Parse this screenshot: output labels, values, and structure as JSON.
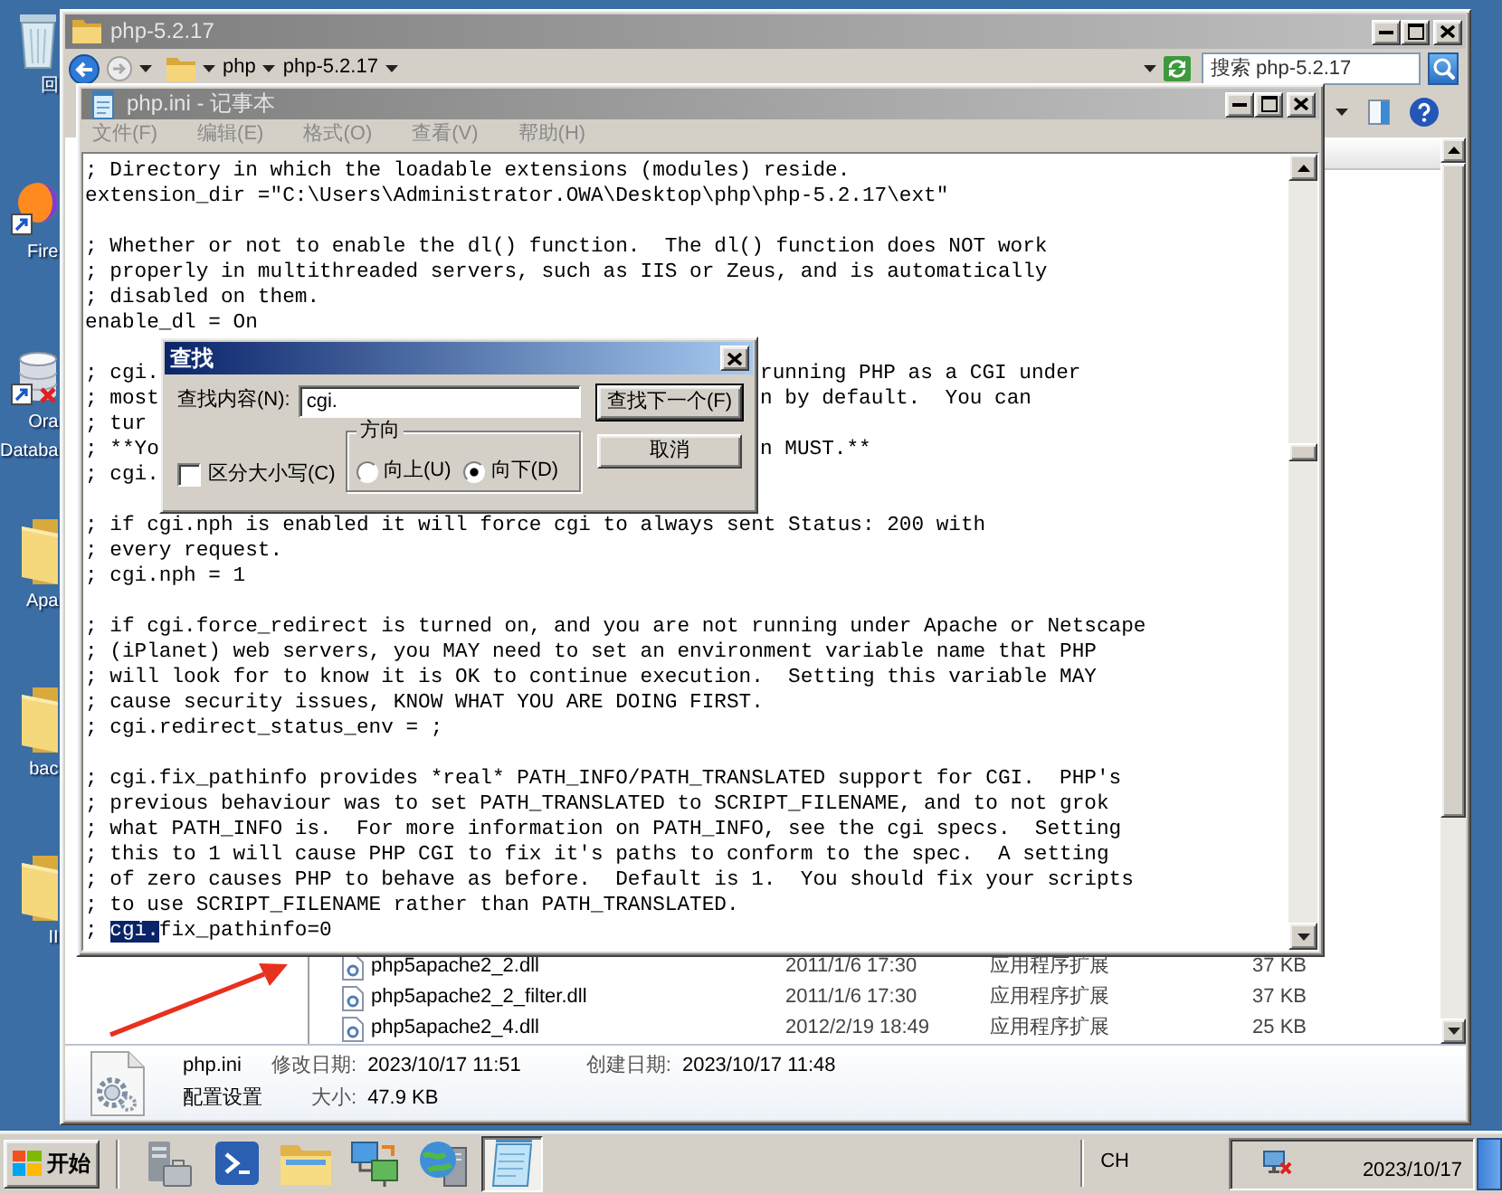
{
  "desktop_icons": [
    {
      "kind": "recycle_bin",
      "label": [
        "回"
      ]
    },
    {
      "kind": "browser_shortcut",
      "label": [
        "Fire"
      ]
    },
    {
      "kind": "database_shortcut",
      "label": [
        "Ora",
        "Databa"
      ]
    },
    {
      "kind": "folder",
      "label": [
        "Apa"
      ]
    },
    {
      "kind": "folder",
      "label": [
        "bac"
      ]
    },
    {
      "kind": "folder",
      "label": [
        "II"
      ]
    }
  ],
  "explorer": {
    "title": "php-5.2.17",
    "breadcrumb": [
      "php",
      "php-5.2.17"
    ],
    "search": {
      "placeholder": "搜索 php-5.2.17"
    },
    "files": [
      {
        "name": "php5apache2_2.dll",
        "modified": "2011/1/6 17:30",
        "type": "应用程序扩展",
        "size": "37 KB"
      },
      {
        "name": "php5apache2_2_filter.dll",
        "modified": "2011/1/6 17:30",
        "type": "应用程序扩展",
        "size": "37 KB"
      },
      {
        "name": "php5apache2_4.dll",
        "modified": "2012/2/19 18:49",
        "type": "应用程序扩展",
        "size": "25 KB"
      }
    ],
    "details": {
      "name": "php.ini",
      "type": "配置设置",
      "fields": [
        {
          "label": "修改日期:",
          "value": "2023/10/17 11:51"
        },
        {
          "label": "创建日期:",
          "value": "2023/10/17 11:48"
        },
        {
          "label": "大小:",
          "value": "47.9 KB"
        }
      ]
    }
  },
  "notepad": {
    "title": "php.ini - 记事本",
    "menu": [
      {
        "label": "文件(F)",
        "disabled": true
      },
      {
        "label": "编辑(E)",
        "disabled": true
      },
      {
        "label": "格式(O)",
        "disabled": true
      },
      {
        "label": "查看(V)",
        "disabled": true
      },
      {
        "label": "帮助(H)",
        "disabled": true
      }
    ],
    "lines": [
      {
        "kind": "text",
        "text": "; Directory in which the loadable extensions (modules) reside."
      },
      {
        "kind": "text",
        "text": "extension_dir =\"C:\\Users\\Administrator.OWA\\Desktop\\php\\php-5.2.17\\ext\""
      },
      {
        "kind": "blank"
      },
      {
        "kind": "text",
        "text": "; Whether or not to enable the dl() function.  The dl() function does NOT work"
      },
      {
        "kind": "text",
        "text": "; properly in multithreaded servers, such as IIS or Zeus, and is automatically"
      },
      {
        "kind": "text",
        "text": "; disabled on them."
      },
      {
        "kind": "text",
        "text": "enable_dl = On"
      },
      {
        "kind": "blank"
      },
      {
        "kind": "covered",
        "left": "; cgi.",
        "right": "running PHP as a CGI under"
      },
      {
        "kind": "covered",
        "left": "; most",
        "right": "n by default.  You can"
      },
      {
        "kind": "covered",
        "left": "; tur"
      },
      {
        "kind": "covered",
        "left": "; **Yo",
        "right": "n MUST.**"
      },
      {
        "kind": "covered",
        "left": "; cgi."
      },
      {
        "kind": "blank"
      },
      {
        "kind": "text",
        "text": "; if cgi.nph is enabled it will force cgi to always sent Status: 200 with"
      },
      {
        "kind": "text",
        "text": "; every request."
      },
      {
        "kind": "text",
        "text": "; cgi.nph = 1"
      },
      {
        "kind": "blank"
      },
      {
        "kind": "text",
        "text": "; if cgi.force_redirect is turned on, and you are not running under Apache or Netscape"
      },
      {
        "kind": "text",
        "text": "; (iPlanet) web servers, you MAY need to set an environment variable name that PHP"
      },
      {
        "kind": "text",
        "text": "; will look for to know it is OK to continue execution.  Setting this variable MAY"
      },
      {
        "kind": "text",
        "text": "; cause security issues, KNOW WHAT YOU ARE DOING FIRST."
      },
      {
        "kind": "text",
        "text": "; cgi.redirect_status_env = ;"
      },
      {
        "kind": "blank"
      },
      {
        "kind": "text",
        "text": "; cgi.fix_pathinfo provides *real* PATH_INFO/PATH_TRANSLATED support for CGI.  PHP's"
      },
      {
        "kind": "text",
        "text": "; previous behaviour was to set PATH_TRANSLATED to SCRIPT_FILENAME, and to not grok"
      },
      {
        "kind": "text",
        "text": "; what PATH_INFO is.  For more information on PATH_INFO, see the cgi specs.  Setting"
      },
      {
        "kind": "text",
        "text": "; this to 1 will cause PHP CGI to fix it's paths to conform to the spec.  A setting"
      },
      {
        "kind": "text",
        "text": "; of zero causes PHP to behave as before.  Default is 1.  You should fix your scripts"
      },
      {
        "kind": "text",
        "text": "; to use SCRIPT_FILENAME rather than PATH_TRANSLATED."
      },
      {
        "kind": "selection",
        "before": "; ",
        "selected": "cgi.",
        "after": "fix_pathinfo=0"
      }
    ]
  },
  "find_dialog": {
    "title": "查找",
    "find_field": {
      "label": "查找内容(N):",
      "value": "cgi."
    },
    "buttons": [
      {
        "kind": "default",
        "label": "查找下一个(F)"
      },
      {
        "kind": "normal",
        "label": "取消"
      }
    ],
    "direction": {
      "label": "方向",
      "options": [
        {
          "label": "向上(U)",
          "selected": false
        },
        {
          "label": "向下(D)",
          "selected": true
        }
      ]
    },
    "match_case": {
      "label": "区分大小写(C)",
      "checked": false
    }
  },
  "taskbar": {
    "start": "开始",
    "apps": [
      {
        "kind": "server_manager",
        "selected": false
      },
      {
        "kind": "powershell",
        "selected": false
      },
      {
        "kind": "explorer",
        "selected": false
      },
      {
        "kind": "network",
        "selected": false
      },
      {
        "kind": "globe_server",
        "selected": false
      },
      {
        "kind": "notepad",
        "selected": true
      }
    ],
    "tray": {
      "language": "CH",
      "date": "2023/10/17"
    }
  }
}
